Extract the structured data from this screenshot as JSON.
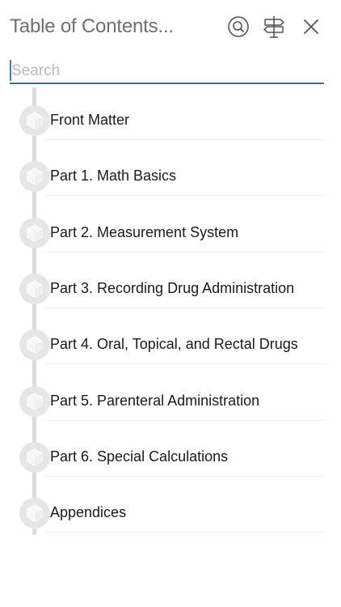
{
  "header": {
    "title": "Table of Contents...",
    "search_button_icon": "search-icon",
    "navigation_button_icon": "signpost-icon",
    "close_button_icon": "close-icon"
  },
  "search": {
    "placeholder": "Search",
    "value": ""
  },
  "toc": {
    "node_icon": "cube-icon",
    "items": [
      {
        "label": "Front Matter"
      },
      {
        "label": "Part 1. Math Basics"
      },
      {
        "label": "Part 2. Measurement System"
      },
      {
        "label": "Part 3. Recording Drug Administration"
      },
      {
        "label": "Part 4. Oral, Topical, and Rectal Drugs"
      },
      {
        "label": "Part 5. Parenteral Administration"
      },
      {
        "label": "Part 6. Special Calculations"
      },
      {
        "label": "Appendices"
      }
    ]
  },
  "colors": {
    "title": "#6f6f6f",
    "search_underline": "#3d6e86",
    "timeline": "#dcdcdc",
    "node": "#e6e6e6"
  }
}
